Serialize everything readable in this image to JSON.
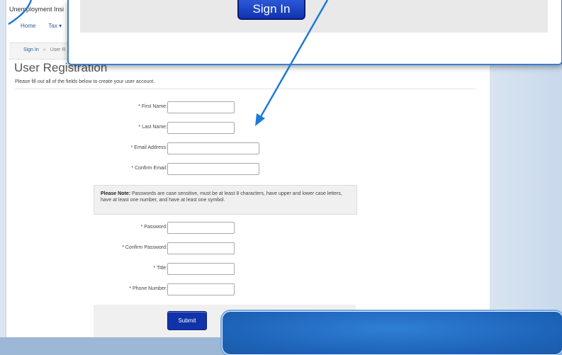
{
  "site": {
    "title": "Unemployment Insi",
    "nav": [
      "Home",
      "Tax ▾"
    ]
  },
  "breadcrumb": {
    "home": "Sign In",
    "separator": "»",
    "current": "User R"
  },
  "heading": "User Registration",
  "intro": "Please fill out all of the fields below to create your user account.",
  "form": {
    "first_name": "* First Name:",
    "last_name": "* Last Name:",
    "email": "* Email Address:",
    "confirm_email": "* Confirm Email:",
    "note_bold": "Please Note:",
    "note_text": " Passwords are case sensitive, must be at least 8 characters, have upper and lower case letters, have at least one number, and have at least one symbol.",
    "password": "* Password:",
    "confirm_password": "* Confirm Password:",
    "title": "* Title:",
    "phone": "* Phone Number:",
    "submit": "Submit"
  },
  "popup": {
    "sign_in": "Sign In"
  },
  "colors": {
    "accent": "#1133aa",
    "arrow": "#1f7ad9"
  }
}
